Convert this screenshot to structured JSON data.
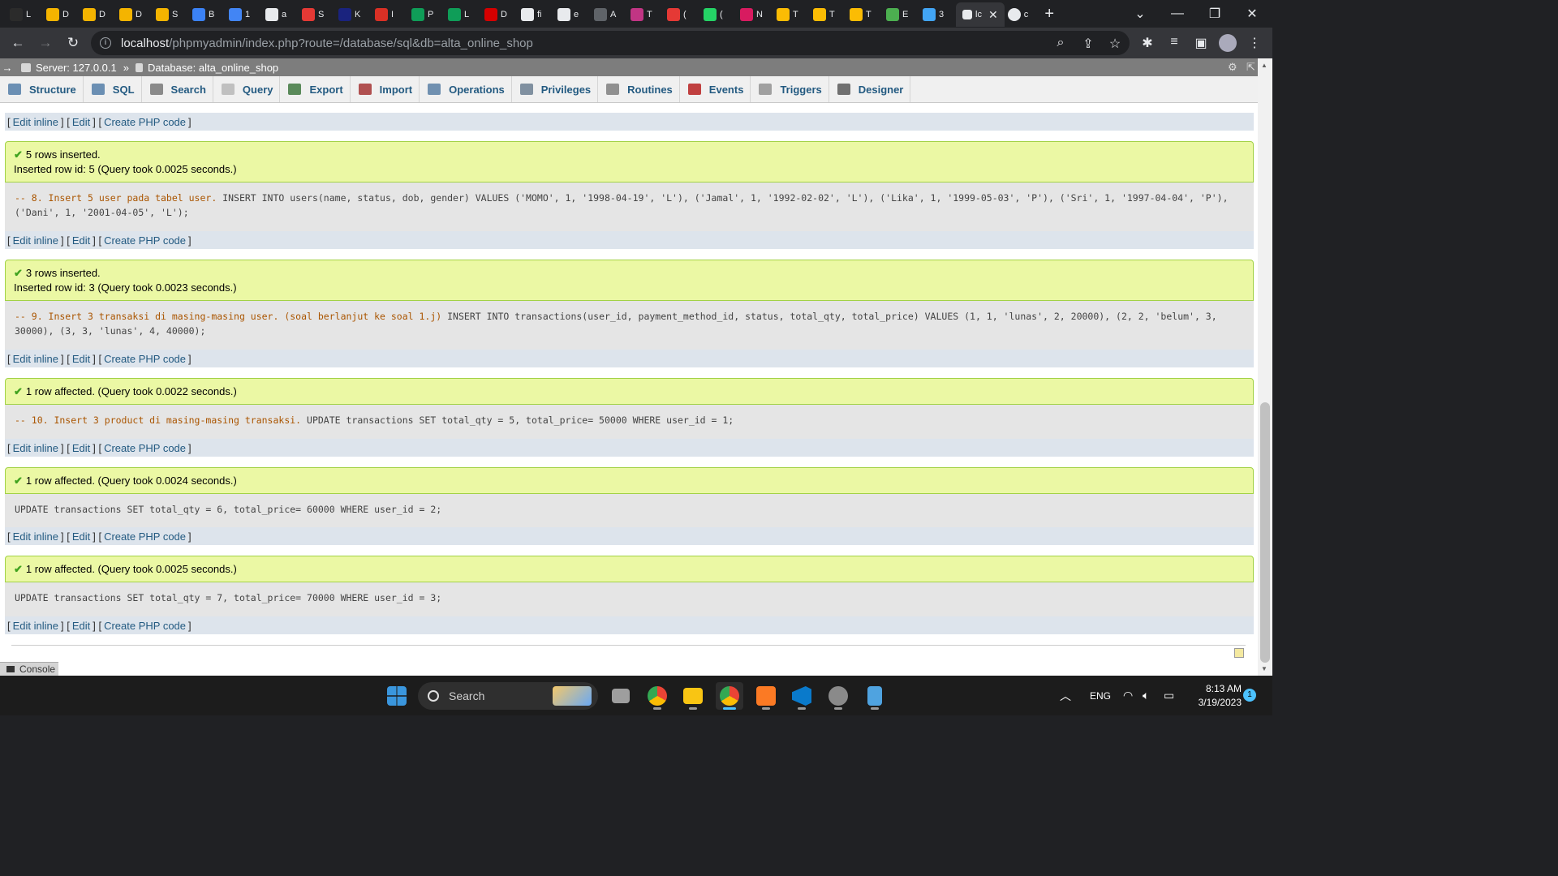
{
  "browser": {
    "tabs": [
      {
        "label": "L",
        "color": "#2b2b2b"
      },
      {
        "label": "D",
        "color": "#f4b400"
      },
      {
        "label": "D",
        "color": "#f4b400"
      },
      {
        "label": "D",
        "color": "#f4b400"
      },
      {
        "label": "S",
        "color": "#f4b400"
      },
      {
        "label": "B",
        "color": "#3b82f6"
      },
      {
        "label": "1",
        "color": "#4285f4"
      },
      {
        "label": "a",
        "color": "#e8eaed"
      },
      {
        "label": "S",
        "color": "#e53935"
      },
      {
        "label": "K",
        "color": "#1a237e"
      },
      {
        "label": "I",
        "color": "#d93025"
      },
      {
        "label": "P",
        "color": "#0f9d58"
      },
      {
        "label": "L",
        "color": "#0f9d58"
      },
      {
        "label": "D",
        "color": "#d50000"
      },
      {
        "label": "fi",
        "color": "#e8eaed"
      },
      {
        "label": "e",
        "color": "#e8eaed"
      },
      {
        "label": "A",
        "color": "#5f6368"
      },
      {
        "label": "T",
        "color": "#c13584"
      },
      {
        "label": "(",
        "color": "#e53935"
      },
      {
        "label": "(",
        "color": "#25d366"
      },
      {
        "label": "N",
        "color": "#d81b60"
      },
      {
        "label": "T",
        "color": "#fbbc04"
      },
      {
        "label": "T",
        "color": "#fbbc04"
      },
      {
        "label": "T",
        "color": "#fbbc04"
      },
      {
        "label": "E",
        "color": "#4caf50"
      },
      {
        "label": "3",
        "color": "#42a5f5"
      }
    ],
    "active_tab": {
      "label": "lc",
      "close": "✕"
    },
    "after_tab": {
      "label": "c"
    },
    "new_tab": "+",
    "url_host": "localhost",
    "url_path": "/phpmyadmin/index.php?route=/database/sql&db=alta_online_shop"
  },
  "pma": {
    "server": "Server: 127.0.0.1",
    "separator": "»",
    "database": "Database: alta_online_shop",
    "menu": [
      {
        "label": "Structure",
        "color": "#6b8fb3"
      },
      {
        "label": "SQL",
        "color": "#6b8fb3"
      },
      {
        "label": "Search",
        "color": "#8a8a8a"
      },
      {
        "label": "Query",
        "color": "#c0c0c0"
      },
      {
        "label": "Export",
        "color": "#5a8a5a"
      },
      {
        "label": "Import",
        "color": "#b05050"
      },
      {
        "label": "Operations",
        "color": "#7090b0"
      },
      {
        "label": "Privileges",
        "color": "#8090a0"
      },
      {
        "label": "Routines",
        "color": "#909090"
      },
      {
        "label": "Events",
        "color": "#c04040"
      },
      {
        "label": "Triggers",
        "color": "#a0a0a0"
      },
      {
        "label": "Designer",
        "color": "#707070"
      }
    ],
    "links": {
      "edit_inline": "Edit inline",
      "edit": "Edit",
      "create_php": "Create PHP code"
    },
    "results": [
      {
        "msg1": "5 rows inserted.",
        "msg2": "Inserted row id: 5 (Query took 0.0025 seconds.)",
        "sql_comment": "-- 8. Insert 5 user pada tabel user.",
        "sql": " INSERT INTO users(name, status, dob, gender) VALUES ('MOMO', 1, '1998-04-19', 'L'), ('Jamal', 1, '1992-02-02', 'L'), ('Lika', 1, '1999-05-03', 'P'), ('Sri', 1, '1997-04-04', 'P'), ('Dani', 1, '2001-04-05', 'L');"
      },
      {
        "msg1": "3 rows inserted.",
        "msg2": "Inserted row id: 3 (Query took 0.0023 seconds.)",
        "sql_comment": "-- 9. Insert 3 transaksi di masing-masing user. (soal berlanjut ke soal 1.j)",
        "sql": " INSERT INTO transactions(user_id, payment_method_id, status, total_qty, total_price) VALUES (1, 1, 'lunas', 2, 20000), (2, 2, 'belum', 3, 30000), (3, 3, 'lunas', 4, 40000);"
      },
      {
        "msg1": "1 row affected. (Query took 0.0022 seconds.)",
        "sql_comment": "-- 10. Insert 3 product di masing-masing transaksi.",
        "sql": " UPDATE transactions SET total_qty = 5, total_price= 50000 WHERE user_id = 1;"
      },
      {
        "msg1": "1 row affected. (Query took 0.0024 seconds.)",
        "sql_comment": "",
        "sql": "UPDATE transactions SET total_qty = 6, total_price= 60000 WHERE user_id = 2;"
      },
      {
        "msg1": "1 row affected. (Query took 0.0025 seconds.)",
        "sql_comment": "",
        "sql": "UPDATE transactions SET total_qty = 7, total_price= 70000 WHERE user_id = 3;"
      }
    ],
    "console": "Console"
  },
  "taskbar": {
    "search_label": "Search",
    "apps": [
      {
        "name": "start",
        "color": "#3a96dd"
      },
      {
        "name": "task-view",
        "color": "#9e9e9e"
      },
      {
        "name": "chrome-profile",
        "color": "#ea4335"
      },
      {
        "name": "file-explorer",
        "color": "#f9c513"
      },
      {
        "name": "chrome",
        "color": "#34a853"
      },
      {
        "name": "xampp",
        "color": "#fb7a24"
      },
      {
        "name": "vscode",
        "color": "#0a7acb"
      },
      {
        "name": "settings",
        "color": "#8a8a8a"
      },
      {
        "name": "notepad",
        "color": "#4fa3e0"
      }
    ],
    "lang": "ENG",
    "time": "8:13 AM",
    "date": "3/19/2023",
    "notif_count": "1"
  }
}
